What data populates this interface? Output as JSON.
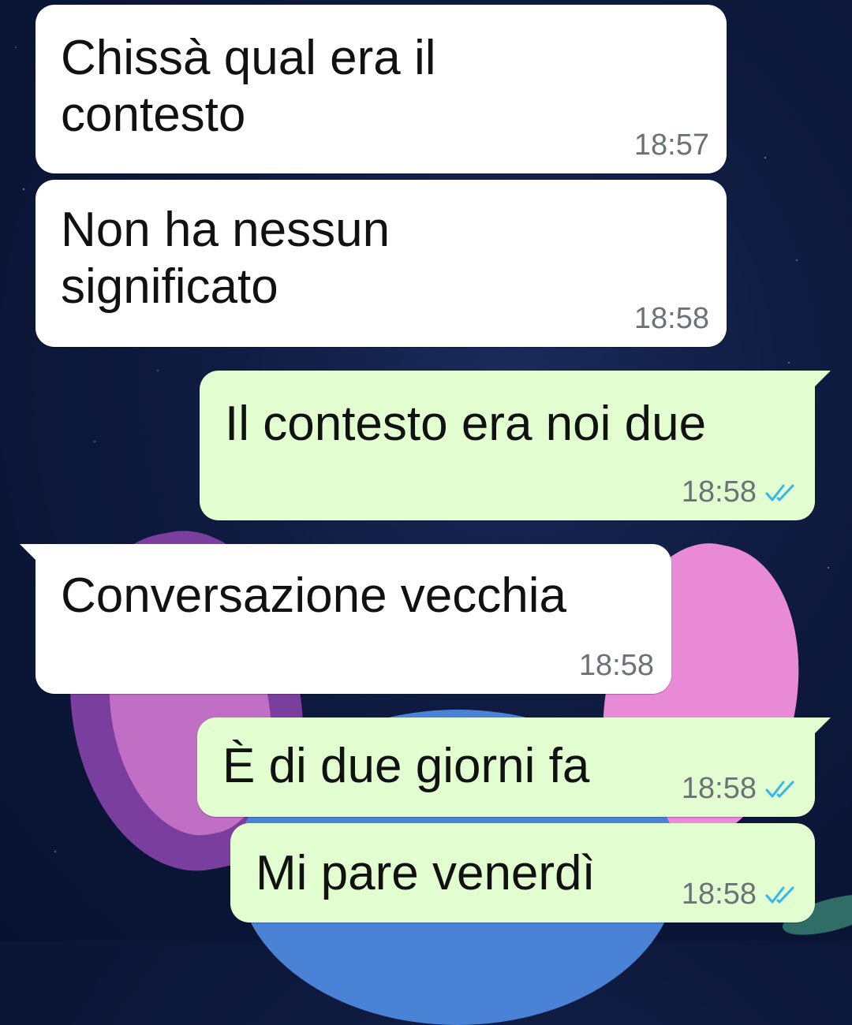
{
  "messages": [
    {
      "direction": "incoming",
      "text": "Chissà qual era il\ncontesto",
      "time": "18:57"
    },
    {
      "direction": "incoming",
      "text": "Non ha nessun\nsignificato",
      "time": "18:58"
    },
    {
      "direction": "outgoing",
      "text": "Il contesto era noi due",
      "time": "18:58",
      "status": "read"
    },
    {
      "direction": "incoming",
      "text": "Conversazione vecchia",
      "time": "18:58"
    },
    {
      "direction": "outgoing",
      "text": "È di due giorni fa",
      "time": "18:58",
      "status": "read"
    },
    {
      "direction": "outgoing",
      "text": "Mi pare venerdì",
      "time": "18:58",
      "status": "read"
    }
  ],
  "colors": {
    "incoming_bubble": "#ffffff",
    "outgoing_bubble": "#e2fdd0",
    "read_ticks": "#34b7f1",
    "timestamp": "#6b7278"
  },
  "icons": {
    "read_receipt": "double-check-icon"
  }
}
